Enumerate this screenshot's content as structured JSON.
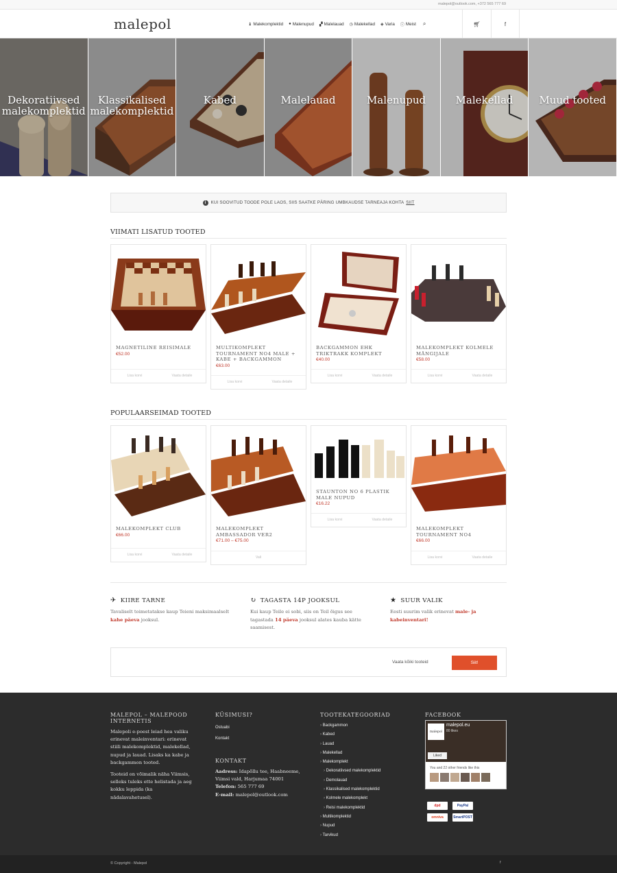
{
  "topbar": {
    "contact": "malepol@outlook.com, +372 565 777 69"
  },
  "header": {
    "logo": "malepol",
    "nav": [
      {
        "label": "Malekomplektid",
        "icon": "chess-piece-icon"
      },
      {
        "label": "Malenupud",
        "icon": "circle-icon"
      },
      {
        "label": "Malelauad",
        "icon": "board-icon"
      },
      {
        "label": "Malekellad",
        "icon": "clock-icon"
      },
      {
        "label": "Varia",
        "icon": "tag-icon"
      },
      {
        "label": "Meist",
        "icon": "info-icon"
      }
    ],
    "cart_icon": "cart-icon",
    "fb_icon": "f"
  },
  "hero": {
    "tiles": [
      {
        "label": "Dekoratiivsed malekomplektid"
      },
      {
        "label": "Klassikalised malekomplektid"
      },
      {
        "label": "Kabed"
      },
      {
        "label": "Malelauad"
      },
      {
        "label": "Malenupud"
      },
      {
        "label": "Malekellad"
      },
      {
        "label": "Muud tooted"
      }
    ]
  },
  "notice": {
    "text": "KUI SOOVITUD TOODE POLE LAOS, SIIS SAATKE PÄRING UMBKAUDSE TARNEAJA KOHTA",
    "link": "SIIT"
  },
  "latest": {
    "title": "VIIMATI LISATUD TOOTED",
    "products": [
      {
        "name": "MAGNETILINE REISIMALE",
        "price": "€52.00",
        "a1": "Lisa korvi",
        "a2": "Vaata detaile"
      },
      {
        "name": "MULTIKOMPLEKT TOURNAMENT NO4 MALE + KABE + BACKGAMMON",
        "price": "€63.00",
        "a1": "Lisa korvi",
        "a2": "Vaata detaile"
      },
      {
        "name": "BACKGAMMON EHK TRIKTRAKK KOMPLEKT",
        "price": "€40.00",
        "a1": "Lisa korvi",
        "a2": "Vaata detaile"
      },
      {
        "name": "MALEKOMPLEKT KOLMELE MÄNGIJALE",
        "price": "€58.00",
        "a1": "Lisa korvi",
        "a2": "Vaata detaile"
      }
    ]
  },
  "popular": {
    "title": "POPULAARSEIMAD TOOTED",
    "products": [
      {
        "name": "MALEKOMPLEKT CLUB",
        "price": "€66.00",
        "a1": "Lisa korvi",
        "a2": "Vaata detaile"
      },
      {
        "name": "MALEKOMPLEKT AMBASSADOR VER2",
        "price": "€71.00 – €75.00",
        "a1": "Vali"
      },
      {
        "name": "STAUNTON NO 6 PLASTIK MALE NUPUD",
        "price": "€16.22",
        "a1": "Lisa korvi",
        "a2": "Vaata detaile"
      },
      {
        "name": "MALEKOMPLEKT TOURNAMENT NO4",
        "price": "€66.00",
        "a1": "Lisa korvi",
        "a2": "Vaata detaile"
      }
    ]
  },
  "features": [
    {
      "title": "KIIRE TARNE",
      "icon": "plane-icon",
      "text": "Tavaliselt toimetatakse kaup Teieni maksimaalselt",
      "highlight": "kahe päeva",
      "tail": "jooksul."
    },
    {
      "title": "TAGASTA 14P JOOKSUL",
      "icon": "refresh-icon",
      "text": "Kui kaup Teile ei sobi, siis on Teil õigus see tagastada",
      "highlight": "14 päeva",
      "tail": "jooksul alates kauba kätte saamisest."
    },
    {
      "title": "SUUR VALIK",
      "icon": "star-icon",
      "text": "Eesti suurim valik erinevat",
      "highlight": "male- ja kabeinventari!",
      "tail": ""
    }
  ],
  "cta": {
    "text": "Vaata kõiki tooteid",
    "button": "Siit!"
  },
  "footer": {
    "about": {
      "title": "MALEPOL – MALEPOOD INTERNETIS",
      "p1": "Malepoli e-poest leiad hea valiku erinevat maleinventari: erinevat stiili malekomplektid, malekellad, nupud ja lauad. Lisaks ka kabe ja backgammon tooted.",
      "p2": "Tooteid on võimalik näha Viimsis, selleks tuleks ette helistada ja aeg kokku leppida (ka nädalavahetusel)."
    },
    "questions": {
      "title": "KÜSIMUSI?",
      "links": [
        "Ostuabi",
        "Kontakt"
      ]
    },
    "contact": {
      "title": "KONTAKT",
      "address_label": "Aadress:",
      "address": "Idapõllu tee, Haabneeme, Viimsi vald, Harjumaa 74001",
      "phone_label": "Telefon:",
      "phone": "565 777 69",
      "email_label": "E-mail:",
      "email": "malepol@outlook.com"
    },
    "categories": {
      "title": "TOOTEKATEGOORIAD",
      "items": [
        {
          "label": "Backgammon",
          "sub": false
        },
        {
          "label": "Kabed",
          "sub": false
        },
        {
          "label": "Lauad",
          "sub": false
        },
        {
          "label": "Malekellad",
          "sub": false
        },
        {
          "label": "Malekomplekt",
          "sub": false
        },
        {
          "label": "Dekoratiivsed malekomplektid",
          "sub": true
        },
        {
          "label": "Demolauad",
          "sub": true
        },
        {
          "label": "Klassikalised malekomplektid",
          "sub": true
        },
        {
          "label": "Kolmele malekomplekt",
          "sub": true
        },
        {
          "label": "Reisi malekomplektid",
          "sub": true
        },
        {
          "label": "Multikomplektid",
          "sub": false
        },
        {
          "label": "Nupud",
          "sub": false
        },
        {
          "label": "Tarvikud",
          "sub": false
        }
      ]
    },
    "facebook": {
      "title": "FACEBOOK",
      "page": "malepol.eu",
      "likes": "80 likes",
      "liked": "Liked",
      "friends": "You and 22 other friends like this",
      "logo": "malepol"
    },
    "payments": [
      "dpd",
      "PayPal",
      "omniva",
      "SmartPOST"
    ]
  },
  "bottom": {
    "copyright": "© Copyright - Malepol",
    "fb": "f"
  }
}
